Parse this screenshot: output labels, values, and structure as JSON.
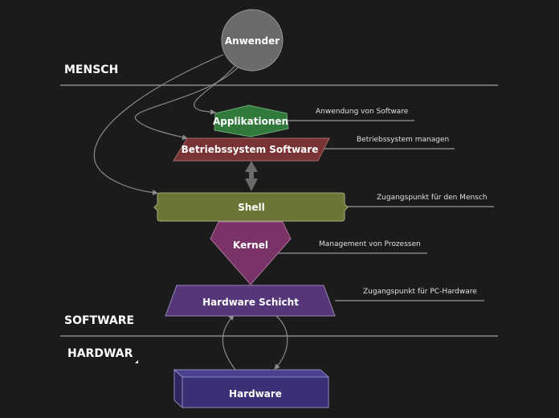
{
  "zones": [
    {
      "id": "mensch",
      "label": "MENSCH"
    },
    {
      "id": "software",
      "label": "SOFTWARE"
    },
    {
      "id": "hardware",
      "label": "HARDWAR"
    }
  ],
  "nodes": {
    "anwender": {
      "label": "Anwender",
      "color": "#6b6b6b",
      "shape": "circle"
    },
    "applikationen": {
      "label": "Applikationen",
      "color": "#327a3c",
      "shape": "hexagon"
    },
    "betriebssystem": {
      "label": "Betriebssystem Software",
      "color": "#7a3334",
      "shape": "parallelogram"
    },
    "shell": {
      "label": "Shell",
      "color": "#6b7535",
      "shape": "brace-rectangle"
    },
    "kernel": {
      "label": "Kernel",
      "color": "#7a3366",
      "shape": "diamond"
    },
    "hardware_schicht": {
      "label": "Hardware Schicht",
      "color": "#553679",
      "shape": "trapezoid"
    },
    "hardware": {
      "label": "Hardware",
      "color": "#3a3075",
      "shape": "box-3d"
    }
  },
  "notes": [
    {
      "target": "applikationen",
      "text": "Anwendung von Software"
    },
    {
      "target": "betriebssystem",
      "text": "Betriebssystem managen"
    },
    {
      "target": "shell",
      "text": "Zugangspunkt für den Mensch"
    },
    {
      "target": "kernel",
      "text": "Management von Prozessen"
    },
    {
      "target": "hardware_schicht",
      "text": "Zugangspunkt für PC-Hardware"
    }
  ],
  "connections": [
    {
      "from": "anwender",
      "to": "applikationen"
    },
    {
      "from": "anwender",
      "to": "betriebssystem"
    },
    {
      "from": "anwender",
      "to": "shell"
    },
    {
      "from": "betriebssystem",
      "to": "shell",
      "type": "bidirectional"
    },
    {
      "from": "hardware",
      "to": "hardware_schicht"
    },
    {
      "from": "hardware_schicht",
      "to": "hardware"
    }
  ],
  "colors": {
    "background": "#1b1b1b",
    "connector": "#8a8a8a",
    "text": "#ffffff"
  }
}
